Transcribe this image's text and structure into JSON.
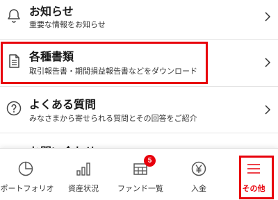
{
  "menu": {
    "items": [
      {
        "title": "お知らせ",
        "subtitle": "重要な情報をお知らせ",
        "icon": "bell-icon"
      },
      {
        "title": "各種書類",
        "subtitle": "取引報告書・期間損益報告書などをダウンロード",
        "icon": "document-icon"
      },
      {
        "title": "よくある質問",
        "subtitle": "みなさまから寄せられる質問とその回答をご紹介",
        "icon": "question-circle-icon"
      },
      {
        "title": "お問い合わせ",
        "icon": "mail-icon"
      }
    ]
  },
  "tabbar": {
    "tabs": [
      {
        "label": "ポートフォリオ",
        "icon": "pie-chart-icon"
      },
      {
        "label": "資産状況",
        "icon": "bar-chart-icon"
      },
      {
        "label": "ファンド一覧",
        "icon": "table-icon",
        "badge": "5"
      },
      {
        "label": "入金",
        "icon": "yen-circle-icon"
      },
      {
        "label": "その他",
        "icon": "hamburger-menu-icon",
        "active": true
      }
    ]
  },
  "colors": {
    "accent": "#e8000b",
    "text": "#1a1a1a",
    "separator": "#e4e4e4"
  }
}
